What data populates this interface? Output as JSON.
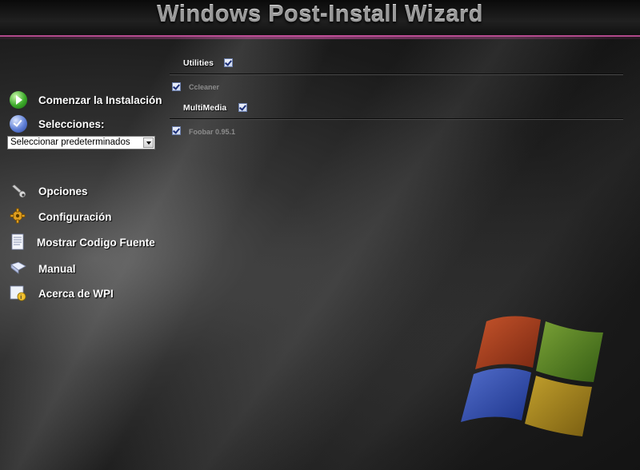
{
  "window": {
    "title": "Windows Post-Install Wizard"
  },
  "sidebar": {
    "begin_install": "Comenzar la Instalación",
    "selections_label": "Selecciones:",
    "selection_dropdown": {
      "selected": "Seleccionar predeterminados"
    },
    "items": [
      {
        "label": "Opciones",
        "icon": "wrench-icon"
      },
      {
        "label": "Configuración",
        "icon": "gear-icon"
      },
      {
        "label": "Mostrar Codigo Fuente",
        "icon": "document-icon"
      },
      {
        "label": "Manual",
        "icon": "book-icon"
      },
      {
        "label": "Acerca de WPI",
        "icon": "info-icon"
      }
    ]
  },
  "programs": {
    "categories": [
      {
        "name": "Utilities",
        "checked": true,
        "items": [
          {
            "name": "Ccleaner",
            "checked": true
          }
        ]
      },
      {
        "name": "MultiMedia",
        "checked": true,
        "items": [
          {
            "name": "Foobar 0.95.1",
            "checked": true
          }
        ]
      }
    ]
  },
  "colors": {
    "accent": "#b04a8a",
    "background": "#1b1b1b"
  }
}
